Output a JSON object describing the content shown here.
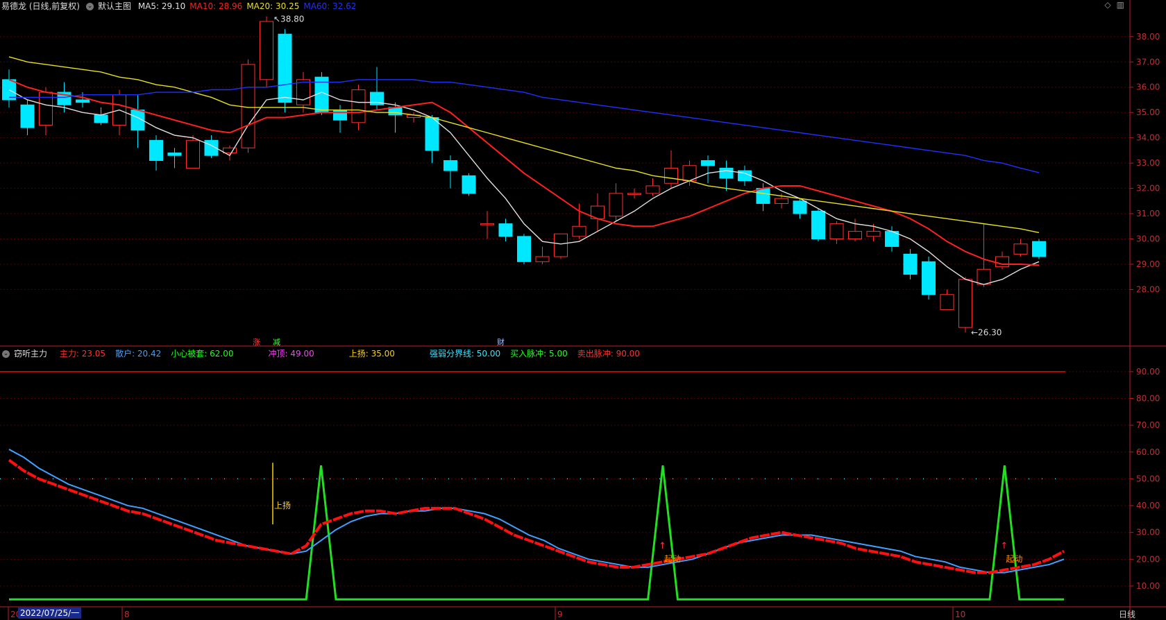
{
  "header": {
    "stock": "易德龙 (日线,前复权)",
    "main_label": "默认主图",
    "ma": [
      {
        "text": "MA5: 29.10",
        "color": "#e0e0e0"
      },
      {
        "text": "MA10: 28.96",
        "color": "#ff2020"
      },
      {
        "text": "MA20: 30.25",
        "color": "#e8e020"
      },
      {
        "text": "MA60: 32.62",
        "color": "#2030ff"
      }
    ]
  },
  "indicator_header": {
    "name": "窃听主力",
    "items": [
      {
        "text": "主力: 23.05",
        "color": "#ff3030"
      },
      {
        "text": "散户: 20.42",
        "color": "#40a0ff"
      },
      {
        "text": "小心被套: 62.00",
        "color": "#20ff20"
      },
      {
        "text": "冲顶: 49.00",
        "color": "#ff40ff"
      },
      {
        "text": "上扬: 35.00",
        "color": "#ffd000"
      },
      {
        "text": "强弱分界线: 50.00",
        "color": "#40e0ff"
      },
      {
        "text": "买入脉冲: 5.00",
        "color": "#20ff20"
      },
      {
        "text": "卖出脉冲: 90.00",
        "color": "#ff3030"
      }
    ]
  },
  "bottom": {
    "date_highlight": "2022/07/25/一",
    "period": "日线"
  },
  "colors": {
    "up": "#ff3030",
    "down": "#00e8ff",
    "grid": "#5a0000",
    "axis": "#c02020"
  },
  "chart_data": [
    {
      "type": "candlestick",
      "ylim": [
        25.9,
        38.9
      ],
      "yticks": [
        28.0,
        29.0,
        30.0,
        31.0,
        32.0,
        33.0,
        34.0,
        35.0,
        36.0,
        37.0,
        38.0
      ],
      "xtick_labels": [
        "20",
        "8",
        "9",
        "10"
      ],
      "annotations": {
        "high": "38.80",
        "low": "26.30",
        "markers": [
          "涨",
          "减",
          "财"
        ]
      },
      "candles": [
        {
          "o": 36.3,
          "c": 35.5,
          "h": 36.7,
          "l": 35.2
        },
        {
          "o": 35.3,
          "c": 34.4,
          "h": 35.5,
          "l": 34.1
        },
        {
          "o": 34.5,
          "c": 35.8,
          "h": 36.0,
          "l": 34.1
        },
        {
          "o": 35.8,
          "c": 35.3,
          "h": 36.2,
          "l": 35.0
        },
        {
          "o": 35.5,
          "c": 35.4,
          "h": 35.8,
          "l": 35.2
        },
        {
          "o": 34.9,
          "c": 34.6,
          "h": 35.2,
          "l": 34.5
        },
        {
          "o": 34.5,
          "c": 35.7,
          "h": 35.9,
          "l": 34.1
        },
        {
          "o": 35.1,
          "c": 34.3,
          "h": 35.7,
          "l": 33.6
        },
        {
          "o": 33.9,
          "c": 33.1,
          "h": 34.1,
          "l": 32.7
        },
        {
          "o": 33.4,
          "c": 33.3,
          "h": 33.6,
          "l": 32.8
        },
        {
          "o": 32.8,
          "c": 33.9,
          "h": 34.1,
          "l": 32.8
        },
        {
          "o": 33.9,
          "c": 33.3,
          "h": 34.1,
          "l": 33.2
        },
        {
          "o": 33.4,
          "c": 33.6,
          "h": 33.7,
          "l": 33.1
        },
        {
          "o": 33.6,
          "c": 36.9,
          "h": 37.1,
          "l": 33.4
        },
        {
          "o": 36.3,
          "c": 38.6,
          "h": 38.8,
          "l": 36.0
        },
        {
          "o": 38.1,
          "c": 35.4,
          "h": 38.3,
          "l": 35.0
        },
        {
          "o": 35.3,
          "c": 36.3,
          "h": 36.6,
          "l": 35.0
        },
        {
          "o": 36.4,
          "c": 35.0,
          "h": 36.6,
          "l": 34.9
        },
        {
          "o": 35.1,
          "c": 34.7,
          "h": 35.3,
          "l": 34.2
        },
        {
          "o": 34.6,
          "c": 35.9,
          "h": 36.1,
          "l": 34.3
        },
        {
          "o": 35.8,
          "c": 35.3,
          "h": 36.8,
          "l": 35.1
        },
        {
          "o": 35.2,
          "c": 34.9,
          "h": 35.4,
          "l": 34.2
        },
        {
          "o": 34.8,
          "c": 34.9,
          "h": 35.0,
          "l": 34.6
        },
        {
          "o": 34.8,
          "c": 33.5,
          "h": 34.9,
          "l": 33.0
        },
        {
          "o": 33.1,
          "c": 32.7,
          "h": 33.3,
          "l": 32.0
        },
        {
          "o": 32.5,
          "c": 31.8,
          "h": 32.6,
          "l": 31.7
        },
        {
          "o": 30.6,
          "c": 30.6,
          "h": 31.1,
          "l": 30.0
        },
        {
          "o": 30.6,
          "c": 30.1,
          "h": 30.8,
          "l": 29.9
        },
        {
          "o": 30.1,
          "c": 29.1,
          "h": 30.2,
          "l": 29.0
        },
        {
          "o": 29.1,
          "c": 29.3,
          "h": 29.7,
          "l": 29.0
        },
        {
          "o": 29.3,
          "c": 30.2,
          "h": 30.2,
          "l": 29.2
        },
        {
          "o": 30.1,
          "c": 30.5,
          "h": 31.4,
          "l": 30.0
        },
        {
          "o": 30.8,
          "c": 31.3,
          "h": 31.8,
          "l": 30.3
        },
        {
          "o": 30.9,
          "c": 31.8,
          "h": 32.2,
          "l": 30.7
        },
        {
          "o": 31.8,
          "c": 31.8,
          "h": 32.0,
          "l": 31.6
        },
        {
          "o": 31.8,
          "c": 32.1,
          "h": 32.4,
          "l": 31.7
        },
        {
          "o": 32.2,
          "c": 32.8,
          "h": 33.5,
          "l": 32.0
        },
        {
          "o": 32.3,
          "c": 32.9,
          "h": 33.1,
          "l": 32.1
        },
        {
          "o": 33.1,
          "c": 32.9,
          "h": 33.3,
          "l": 32.2
        },
        {
          "o": 32.8,
          "c": 32.4,
          "h": 33.1,
          "l": 31.9
        },
        {
          "o": 32.7,
          "c": 32.3,
          "h": 32.9,
          "l": 32.1
        },
        {
          "o": 32.0,
          "c": 31.4,
          "h": 32.2,
          "l": 31.1
        },
        {
          "o": 31.4,
          "c": 31.6,
          "h": 31.8,
          "l": 31.2
        },
        {
          "o": 31.5,
          "c": 31.0,
          "h": 31.6,
          "l": 30.8
        },
        {
          "o": 31.1,
          "c": 30.0,
          "h": 31.2,
          "l": 29.9
        },
        {
          "o": 30.0,
          "c": 30.6,
          "h": 30.7,
          "l": 29.8
        },
        {
          "o": 30.0,
          "c": 30.3,
          "h": 30.8,
          "l": 29.9
        },
        {
          "o": 30.1,
          "c": 30.3,
          "h": 30.6,
          "l": 29.9
        },
        {
          "o": 30.3,
          "c": 29.7,
          "h": 30.5,
          "l": 29.5
        },
        {
          "o": 29.4,
          "c": 28.6,
          "h": 29.6,
          "l": 28.4
        },
        {
          "o": 29.1,
          "c": 27.8,
          "h": 29.3,
          "l": 27.6
        },
        {
          "o": 27.2,
          "c": 27.8,
          "h": 28.0,
          "l": 27.2
        },
        {
          "o": 26.5,
          "c": 28.4,
          "h": 28.5,
          "l": 26.3
        },
        {
          "o": 28.2,
          "c": 28.8,
          "h": 30.6,
          "l": 28.1
        },
        {
          "o": 28.9,
          "c": 29.3,
          "h": 29.5,
          "l": 28.8
        },
        {
          "o": 29.4,
          "c": 29.8,
          "h": 30.0,
          "l": 29.3
        },
        {
          "o": 29.9,
          "c": 29.3,
          "h": 30.0,
          "l": 29.2
        }
      ],
      "series": [
        {
          "name": "MA5",
          "color": "#e0e0e0",
          "values": [
            35.9,
            35.5,
            35.3,
            35.2,
            35.0,
            34.9,
            35.1,
            34.8,
            34.4,
            34.1,
            34.0,
            33.7,
            33.3,
            34.5,
            35.5,
            35.6,
            35.5,
            35.8,
            35.5,
            35.4,
            35.4,
            35.3,
            35.1,
            34.8,
            34.2,
            33.3,
            32.4,
            31.6,
            30.6,
            29.9,
            29.8,
            29.9,
            30.3,
            30.7,
            31.1,
            31.6,
            32.0,
            32.3,
            32.6,
            32.7,
            32.6,
            32.3,
            31.9,
            31.6,
            31.2,
            30.8,
            30.6,
            30.5,
            30.3,
            30.0,
            29.5,
            28.9,
            28.4,
            28.2,
            28.4,
            28.8,
            29.1
          ]
        },
        {
          "name": "MA10",
          "color": "#ff2020",
          "values": [
            36.3,
            36.0,
            35.8,
            35.7,
            35.6,
            35.4,
            35.3,
            35.1,
            34.9,
            34.7,
            34.5,
            34.3,
            34.2,
            34.5,
            34.8,
            34.8,
            34.9,
            35.0,
            35.0,
            35.0,
            35.1,
            35.2,
            35.3,
            35.4,
            35.0,
            34.4,
            33.8,
            33.2,
            32.6,
            32.1,
            31.6,
            31.1,
            30.8,
            30.6,
            30.5,
            30.5,
            30.7,
            30.9,
            31.2,
            31.5,
            31.8,
            32.0,
            32.1,
            32.1,
            31.9,
            31.7,
            31.5,
            31.3,
            31.1,
            30.8,
            30.4,
            29.9,
            29.5,
            29.2,
            29.0,
            29.0,
            28.96
          ]
        },
        {
          "name": "MA20",
          "color": "#e8e020",
          "values": [
            37.2,
            37.0,
            36.9,
            36.8,
            36.7,
            36.6,
            36.4,
            36.3,
            36.1,
            36.0,
            35.8,
            35.6,
            35.3,
            35.2,
            35.2,
            35.2,
            35.2,
            35.1,
            35.1,
            35.1,
            35.0,
            35.0,
            34.9,
            34.8,
            34.6,
            34.4,
            34.2,
            34.0,
            33.8,
            33.6,
            33.4,
            33.2,
            33.0,
            32.8,
            32.7,
            32.5,
            32.4,
            32.3,
            32.1,
            32.0,
            31.9,
            31.8,
            31.7,
            31.6,
            31.5,
            31.4,
            31.3,
            31.2,
            31.1,
            31.0,
            30.9,
            30.8,
            30.7,
            30.6,
            30.5,
            30.4,
            30.25
          ]
        },
        {
          "name": "MA60",
          "color": "#2030ff",
          "values": [
            35.6,
            35.6,
            35.6,
            35.6,
            35.7,
            35.7,
            35.7,
            35.7,
            35.8,
            35.8,
            35.8,
            35.9,
            35.9,
            36.0,
            36.0,
            36.1,
            36.2,
            36.2,
            36.2,
            36.3,
            36.3,
            36.3,
            36.3,
            36.2,
            36.2,
            36.1,
            36.0,
            35.9,
            35.8,
            35.6,
            35.5,
            35.4,
            35.3,
            35.2,
            35.1,
            35.0,
            34.9,
            34.8,
            34.7,
            34.6,
            34.5,
            34.4,
            34.3,
            34.2,
            34.1,
            34.0,
            33.9,
            33.8,
            33.7,
            33.6,
            33.5,
            33.4,
            33.3,
            33.1,
            33.0,
            32.8,
            32.62
          ]
        }
      ]
    },
    {
      "type": "line",
      "ylim": [
        3,
        98
      ],
      "yticks": [
        10.0,
        20.0,
        30.0,
        40.0,
        50.0,
        60.0,
        70.0,
        80.0,
        90.0
      ],
      "reference_lines": [
        {
          "y": 90,
          "color": "#ff0000"
        },
        {
          "y": 50,
          "color": "#40e0ff",
          "style": "dotted"
        }
      ],
      "annotations": {
        "shangyang": "上扬",
        "qidong": "起动"
      },
      "series": [
        {
          "name": "主力",
          "color": "#ff1010",
          "values": [
            57,
            53,
            50,
            48,
            46,
            44,
            42,
            40,
            38,
            37,
            35,
            33,
            31,
            29,
            27,
            26,
            25,
            24,
            23,
            22,
            25,
            33,
            35,
            37,
            38,
            38,
            37,
            38,
            39,
            39,
            39,
            37,
            35,
            32,
            29,
            27,
            25,
            23,
            21,
            19,
            18,
            17,
            17,
            18,
            19,
            20,
            21,
            22,
            24,
            26,
            28,
            29,
            30,
            29,
            28,
            27,
            26,
            24,
            23,
            22,
            21,
            19,
            18,
            17,
            16,
            15,
            15,
            16,
            17,
            18,
            20,
            23
          ]
        },
        {
          "name": "散户",
          "color": "#40a0ff",
          "values": [
            61,
            58,
            54,
            51,
            48,
            46,
            44,
            42,
            40,
            39,
            37,
            35,
            33,
            31,
            29,
            27,
            25,
            24,
            23,
            22,
            23,
            27,
            31,
            34,
            36,
            37,
            37,
            38,
            38,
            39,
            39,
            38,
            37,
            35,
            32,
            29,
            27,
            24,
            22,
            20,
            19,
            18,
            17,
            17,
            18,
            19,
            20,
            22,
            24,
            26,
            27,
            28,
            29,
            29,
            29,
            28,
            27,
            26,
            25,
            24,
            23,
            21,
            20,
            19,
            17,
            16,
            15,
            15,
            16,
            17,
            18,
            20
          ]
        },
        {
          "name": "脉冲",
          "color": "#20e020",
          "values": [
            5,
            5,
            5,
            5,
            5,
            5,
            5,
            5,
            5,
            5,
            5,
            5,
            5,
            5,
            5,
            5,
            5,
            5,
            5,
            5,
            5,
            55,
            5,
            5,
            5,
            5,
            5,
            5,
            5,
            5,
            5,
            5,
            5,
            5,
            5,
            5,
            5,
            5,
            5,
            5,
            5,
            5,
            5,
            5,
            55,
            5,
            5,
            5,
            5,
            5,
            5,
            5,
            5,
            5,
            5,
            5,
            5,
            5,
            5,
            5,
            5,
            5,
            5,
            5,
            5,
            5,
            5,
            55,
            5,
            5,
            5,
            5
          ]
        }
      ]
    }
  ]
}
